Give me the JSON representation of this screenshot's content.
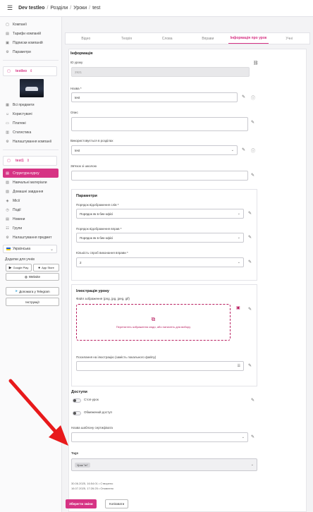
{
  "breadcrumb": [
    "Dev testleo",
    "Розділи",
    "Уроки",
    "test"
  ],
  "sidebar": {
    "top_items": [
      {
        "icon": "building-icon",
        "glyph": "▢",
        "label": "Компанії"
      },
      {
        "icon": "tariff-icon",
        "glyph": "▤",
        "label": "Тарифи компаній"
      },
      {
        "icon": "subscription-icon",
        "glyph": "▣",
        "label": "Підписки компаній"
      },
      {
        "icon": "gear-icon",
        "glyph": "⚙",
        "label": "Параметри"
      }
    ],
    "org1": {
      "name": "testleo",
      "chevron": "⇕"
    },
    "org1_items": [
      {
        "icon": "subjects-icon",
        "glyph": "▦",
        "label": "Всі предмети"
      },
      {
        "icon": "users-icon",
        "glyph": "☺",
        "label": "Користувачі"
      },
      {
        "icon": "payments-icon",
        "glyph": "▭",
        "label": "Платежі"
      },
      {
        "icon": "stats-icon",
        "glyph": "▥",
        "label": "Статистика"
      },
      {
        "icon": "settings-icon",
        "glyph": "⚙",
        "label": "Налаштування компанії"
      }
    ],
    "org2": {
      "name": "test1",
      "chevron": "⇕"
    },
    "org2_items": [
      {
        "icon": "course-structure-icon",
        "glyph": "▤",
        "label": "Структура курсу",
        "active": true
      },
      {
        "icon": "materials-icon",
        "glyph": "▧",
        "label": "Навчальні матеріали"
      },
      {
        "icon": "homework-icon",
        "glyph": "▨",
        "label": "Домашні завдання"
      },
      {
        "icon": "missions-icon",
        "glyph": "◈",
        "label": "Місії"
      },
      {
        "icon": "events-icon",
        "glyph": "◷",
        "label": "Події"
      },
      {
        "icon": "news-icon",
        "glyph": "▤",
        "label": "Новини"
      },
      {
        "icon": "groups-icon",
        "glyph": "☷",
        "label": "Групи"
      },
      {
        "icon": "subject-settings-icon",
        "glyph": "⚙",
        "label": "Налаштування предмет"
      }
    ],
    "language": "Українська",
    "apps_label": "Додатки для учнів",
    "google_play": "Google Play",
    "app_store": "App Store",
    "website": "Website",
    "telegram": "Допомога у Telegram",
    "instructions": "Інструкції"
  },
  "tabs": [
    {
      "label": "Відео",
      "active": false
    },
    {
      "label": "Теорія",
      "active": false
    },
    {
      "label": "Слова",
      "active": false
    },
    {
      "label": "Вправи",
      "active": false
    },
    {
      "label": "Інформація про урок",
      "active": true
    },
    {
      "label": "Учні",
      "active": false
    }
  ],
  "form": {
    "info_title": "Інформація",
    "lesson_id_label": "ID уроку",
    "lesson_id_value": "2921",
    "name_label": "Назва *",
    "name_value": "test",
    "description_label": "Опис",
    "description_value": "",
    "used_in_sections_label": "Використовується в розділах",
    "used_in_sections_value": "test",
    "school_link_label": "Зв'язок зі школою",
    "school_link_value": "",
    "params_title": "Параметри",
    "words_order_label": "Порядок відображення слів *",
    "words_order_value": "Порядок як в бек-офісі",
    "exercises_order_label": "Порядок відображення вправ *",
    "exercises_order_value": "Порядок як в бек-офісі",
    "attempts_label": "Кількість спроб виконання вправи *",
    "attempts_value": "2",
    "illustration_title": "Ілюстрація уроку",
    "image_file_label": "Файл зображення (png, jpg, jpeg, gif)",
    "drop_text": "Перетягніть зображення сюди, або натисніть для вибору",
    "image_url_label": "Посилання на ілюстрацію (замість локального файлу)",
    "image_url_value": "",
    "access_title": "Доступи",
    "stop_lesson_label": "Стоп-урок",
    "limited_access_label": "Обмежений доступ",
    "certificate_label": "Назва шаблону сертифіката",
    "certificate_value": "",
    "tags_label": "Tags",
    "tag_chip": "Урок \"m\"",
    "created_text": "30.06.2025, 16:54:01 • Створено",
    "updated_text": "16.07.2025, 17:26:25 • Оновлено",
    "save_button": "Зберегти зміни",
    "copy_button": "Копіювати"
  },
  "colors": {
    "accent": "#d63384",
    "arrow": "#e8191b"
  }
}
